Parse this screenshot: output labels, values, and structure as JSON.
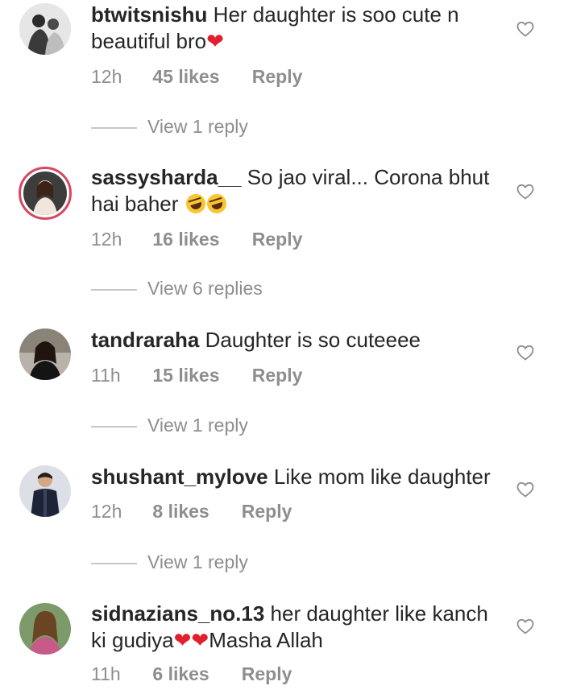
{
  "comments": [
    {
      "username": "btwitsnishu",
      "text_parts": [
        "Her daughter is soo cute n beautiful bro"
      ],
      "emoji": [
        "red-heart"
      ],
      "time": "12h",
      "likes": "45 likes",
      "reply": "Reply",
      "view_replies": "View 1 reply"
    },
    {
      "username": "sassysharda__",
      "text_parts": [
        "So jao viral... Corona bhut hai baher"
      ],
      "emoji": [
        "rolling-laughing",
        "rolling-laughing"
      ],
      "time": "12h",
      "likes": "16 likes",
      "reply": "Reply",
      "view_replies": "View 6 replies"
    },
    {
      "username": "tandraraha",
      "text_parts": [
        "Daughter is so cuteeee"
      ],
      "time": "11h",
      "likes": "15 likes",
      "reply": "Reply",
      "view_replies": "View 1 reply"
    },
    {
      "username": "shushant_mylove",
      "text_parts": [
        "Like mom like daughter"
      ],
      "time": "12h",
      "likes": "8 likes",
      "reply": "Reply",
      "view_replies": "View 1 reply"
    },
    {
      "username": "sidnazians_no.13",
      "text_parts": [
        "her daughter like kanch ki gudiya",
        "Masha Allah"
      ],
      "emoji": [
        "red-heart",
        "red-heart"
      ],
      "time": "11h",
      "likes": "6 likes",
      "reply": "Reply"
    }
  ],
  "icons": {
    "like": "heart-outline-icon",
    "emoji_heart": "red-heart-emoji",
    "emoji_laugh": "rolling-on-floor-laughing-emoji"
  },
  "colors": {
    "text": "#262626",
    "meta": "#8e8e8e",
    "heart": "#e0202e",
    "story_ring": "#d8475f"
  }
}
